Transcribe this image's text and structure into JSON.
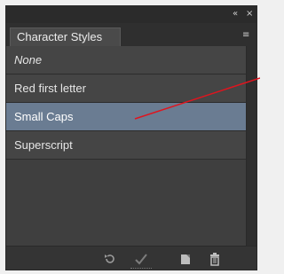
{
  "panel": {
    "tab_title": "Character Styles",
    "topbar": {
      "collapse_glyph": "«",
      "close_glyph": "×"
    },
    "menu_glyph": "≡",
    "styles": [
      {
        "label": "None",
        "italic": true,
        "selected": false
      },
      {
        "label": "Red first letter",
        "italic": false,
        "selected": false
      },
      {
        "label": "Small Caps",
        "italic": false,
        "selected": true
      },
      {
        "label": "Superscript",
        "italic": false,
        "selected": false
      }
    ],
    "bottom_icons": [
      "clear-overrides-icon",
      "redefine-style-icon",
      "new-style-icon",
      "delete-style-icon"
    ],
    "colors": {
      "selected_row": "#6a7c92",
      "annotation_line": "#e0141e"
    }
  }
}
